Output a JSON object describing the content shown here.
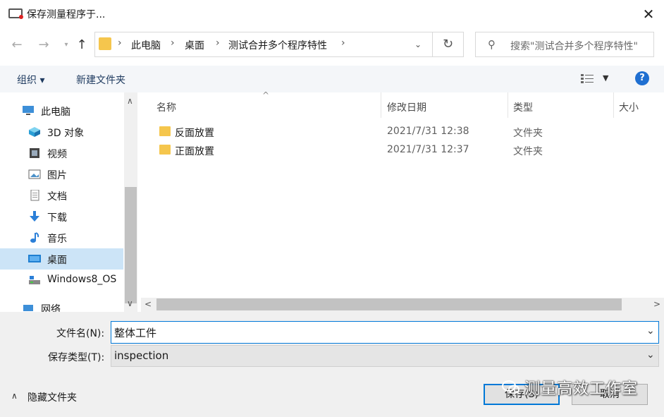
{
  "window": {
    "title": "保存测量程序于..."
  },
  "address": {
    "crumbs": [
      "此电脑",
      "桌面",
      "测试合并多个程序特性"
    ],
    "search_placeholder": "搜索\"测试合并多个程序特性\""
  },
  "toolbar": {
    "organize_label": "组织 ▾",
    "new_folder_label": "新建文件夹",
    "help_label": "?"
  },
  "nav": {
    "items": [
      {
        "label": "此电脑",
        "icon": "computer-icon"
      },
      {
        "label": "3D 对象",
        "icon": "cube-icon"
      },
      {
        "label": "视频",
        "icon": "video-icon"
      },
      {
        "label": "图片",
        "icon": "picture-icon"
      },
      {
        "label": "文档",
        "icon": "document-icon"
      },
      {
        "label": "下载",
        "icon": "download-icon"
      },
      {
        "label": "音乐",
        "icon": "music-icon"
      },
      {
        "label": "桌面",
        "icon": "desktop-icon",
        "selected": true
      },
      {
        "label": "Windows8_OS",
        "icon": "drive-icon"
      },
      {
        "label": "网络",
        "icon": "network-icon"
      }
    ]
  },
  "files": {
    "columns": [
      "名称",
      "修改日期",
      "类型",
      "大小"
    ],
    "rows": [
      {
        "name": "反面放置",
        "date": "2021/7/31 12:38",
        "type": "文件夹"
      },
      {
        "name": "正面放置",
        "date": "2021/7/31 12:37",
        "type": "文件夹"
      }
    ]
  },
  "form": {
    "filename_label": "文件名(N):",
    "filename_value": "整体工件",
    "filetype_label": "保存类型(T):",
    "filetype_value": "inspection"
  },
  "footer": {
    "hide_folders_label": "隐藏文件夹",
    "save_label": "保存(S)",
    "cancel_label": "取消"
  },
  "watermark": {
    "text": "测量高效工作室"
  },
  "colors": {
    "accent": "#0078d7",
    "folder": "#f5c64d",
    "selected": "#cce4f7",
    "help": "#1f6fd1"
  }
}
